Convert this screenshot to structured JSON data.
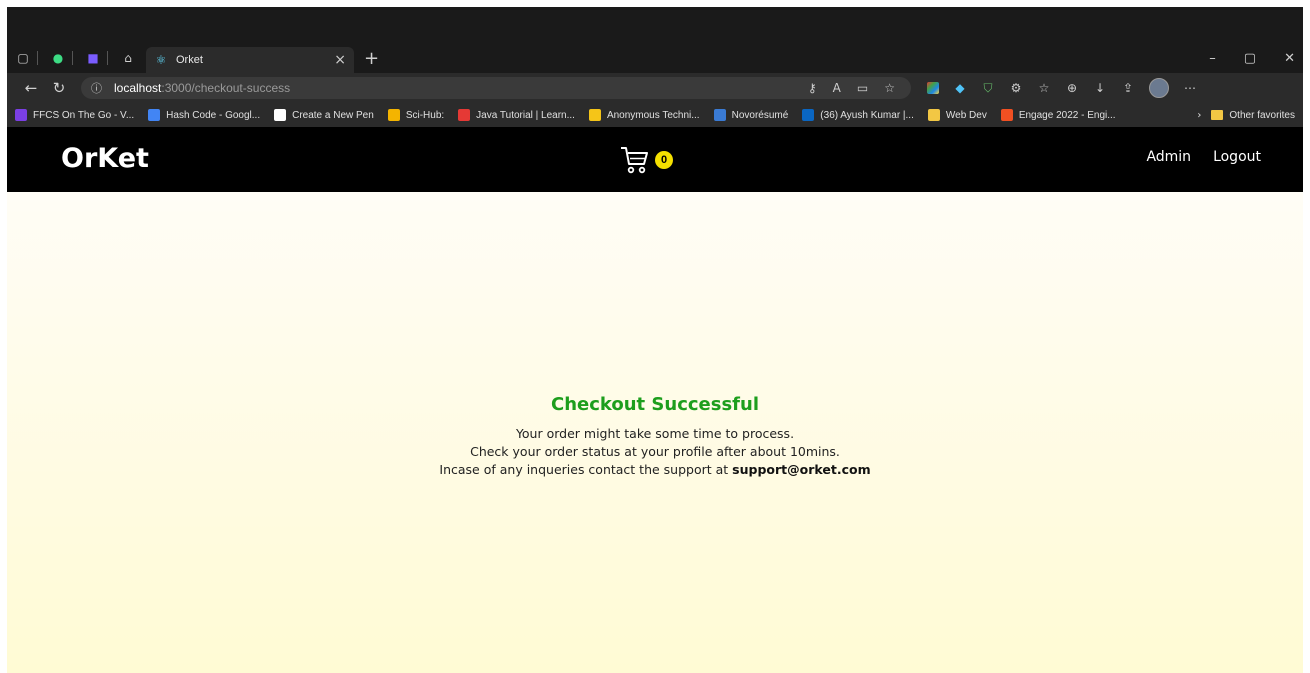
{
  "browser": {
    "tab_title": "Orket",
    "url_host": "localhost",
    "url_path": ":3000/checkout-success",
    "bookmarks": [
      {
        "label": "FFCS On The Go - V...",
        "color": "#7b3fe4"
      },
      {
        "label": "Hash Code - Googl...",
        "color": "#4285f4"
      },
      {
        "label": "Create a New Pen",
        "color": "#ffffff"
      },
      {
        "label": "Sci-Hub:",
        "color": "#f4b400"
      },
      {
        "label": "Java Tutorial | Learn...",
        "color": "#e53935"
      },
      {
        "label": "Anonymous Techni...",
        "color": "#f5c518"
      },
      {
        "label": "Novorésumé",
        "color": "#3a7bd5"
      },
      {
        "label": "(36) Ayush Kumar |...",
        "color": "#0a66c2"
      },
      {
        "label": "Web Dev",
        "color": "#f2c744"
      },
      {
        "label": "Engage 2022 - Engi...",
        "color": "#f25022"
      }
    ],
    "other_favorites": "Other favorites"
  },
  "navbar": {
    "brand": "OrKet",
    "cart_count": "0",
    "links": {
      "admin": "Admin",
      "logout": "Logout"
    }
  },
  "success": {
    "title": "Checkout Successful",
    "line1": "Your order might take some time to process.",
    "line2": "Check your order status at your profile after about 10mins.",
    "line3_prefix": "Incase of any inqueries contact the support at ",
    "support_email": "support@orket.com"
  },
  "colors": {
    "navbar_bg": "#000000",
    "success_title": "#1d9e1d",
    "cart_badge": "#f5e000"
  }
}
